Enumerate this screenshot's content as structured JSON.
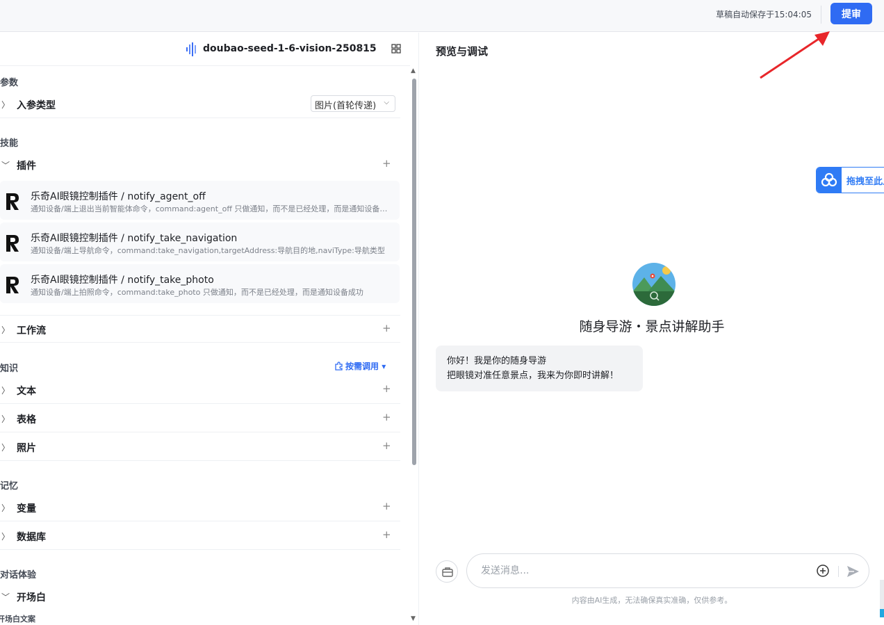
{
  "topbar": {
    "autosave_text": "草稿自动保存于15:04:05",
    "submit_label": "提审"
  },
  "model": {
    "name": "doubao-seed-1-6-vision-250815"
  },
  "params": {
    "section_title": "参数",
    "input_type_label": "入参类型",
    "input_type_value": "图片(首轮传递)"
  },
  "skills": {
    "section_title": "技能",
    "plugin_label": "插件",
    "plugins": [
      {
        "name": "乐奇AI眼镜控制插件 / notify_agent_off",
        "desc": "通知设备/端上退出当前智能体命令，command:agent_off 只做通知，而不是已经处理，而是通知设备成功"
      },
      {
        "name": "乐奇AI眼镜控制插件 / notify_take_navigation",
        "desc": "通知设备/端上导航命令，command:take_navigation,targetAddress:导航目的地,naviType:导航类型"
      },
      {
        "name": "乐奇AI眼镜控制插件 / notify_take_photo",
        "desc": "通知设备/端上拍照命令，command:take_photo 只做通知，而不是已经处理，而是通知设备成功"
      }
    ],
    "workflow_label": "工作流"
  },
  "knowledge": {
    "section_title": "知识",
    "ondemand_label": "按需调用",
    "items": [
      "文本",
      "表格",
      "照片"
    ]
  },
  "memory": {
    "section_title": "记忆",
    "items": [
      "变量",
      "数据库"
    ]
  },
  "dialog": {
    "section_title": "对话体验",
    "opening_label": "开场白",
    "opening_text_label": "开场白文案"
  },
  "preview": {
    "title": "预览与调试",
    "drag_label": "拖拽至此上传",
    "bot_name": "随身导游・景点讲解助手",
    "greeting_line1": "你好！我是你的随身导游",
    "greeting_line2": "把眼镜对准任意景点，我来为你即时讲解！",
    "input_placeholder": "发送消息...",
    "disclaimer": "内容由AI生成，无法确保真实准确，仅供参考。"
  },
  "colors": {
    "accent": "#2f6bf3",
    "arrow": "#e8262a"
  }
}
